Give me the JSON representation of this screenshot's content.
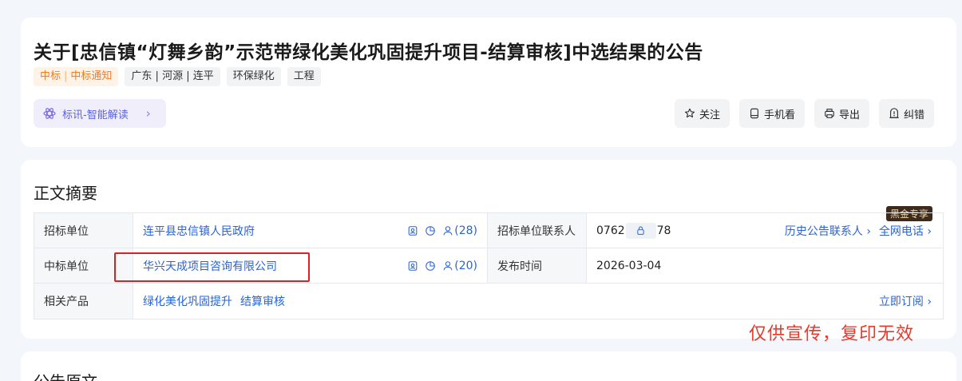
{
  "header": {
    "title": "关于[忠信镇“灯舞乡韵”示范带绿化美化巩固提升项目-结算审核]中选结果的公告",
    "tags": {
      "type_a": "中标",
      "type_b": "中标通知",
      "region": "广东 | 河源 | 连平",
      "category": "环保绿化",
      "kind": "工程"
    },
    "ai_button": "标讯-智能解读",
    "actions": {
      "follow": "关注",
      "mobile": "手机看",
      "export": "导出",
      "correct": "纠错"
    }
  },
  "summary": {
    "title": "正文摘要",
    "badge": "黑金专享",
    "rows": {
      "buyer_label": "招标单位",
      "buyer_value": "连平县忠信镇人民政府",
      "buyer_count": "(28)",
      "contact_label": "招标单位联系人",
      "contact_prefix": "0762",
      "contact_suffix": "78",
      "history_link": "历史公告联系人 ›",
      "phone_link": "全网电话 ›",
      "winner_label": "中标单位",
      "winner_value": "华兴天成项目咨询有限公司",
      "winner_count": "(20)",
      "publish_label": "发布时间",
      "publish_value": "2026-03-04",
      "product_label": "相关产品",
      "product_a": "绿化美化巩固提升",
      "product_b": "结算审核",
      "subscribe": "立即订阅 ›"
    }
  },
  "watermark": "仅供宣传，复印无效",
  "original": {
    "title": "公告原文"
  }
}
